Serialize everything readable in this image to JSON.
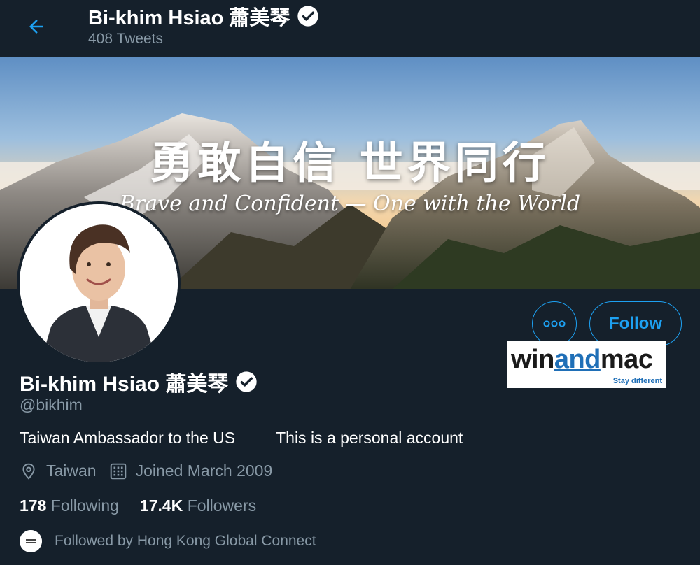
{
  "header": {
    "display_name": "Bi-khim Hsiao 蕭美琴",
    "tweet_count": "408 Tweets",
    "back_icon": "arrow-left-icon"
  },
  "banner": {
    "title": "勇敢自信 世界同行",
    "subtitle": "Brave and Confident — One with the World"
  },
  "actions": {
    "more_icon": "more-dots-icon",
    "follow_label": "Follow"
  },
  "watermark": {
    "win": "win",
    "and": "and",
    "mac": "mac",
    "tagline": "Stay different"
  },
  "profile": {
    "display_name": "Bi-khim Hsiao 蕭美琴",
    "handle": "@bikhim",
    "bio_part1": "Taiwan Ambassador to the US",
    "bio_part2": "This is a personal account",
    "location": "Taiwan",
    "joined": "Joined March 2009",
    "following_count": "178",
    "following_label": "Following",
    "followers_count": "17.4K",
    "followers_label": "Followers",
    "followed_by": "Followed by Hong Kong Global Connect"
  },
  "colors": {
    "background": "#15202b",
    "accent": "#1da1f2",
    "secondary_text": "#8899a6",
    "primary_text": "#ffffff"
  }
}
